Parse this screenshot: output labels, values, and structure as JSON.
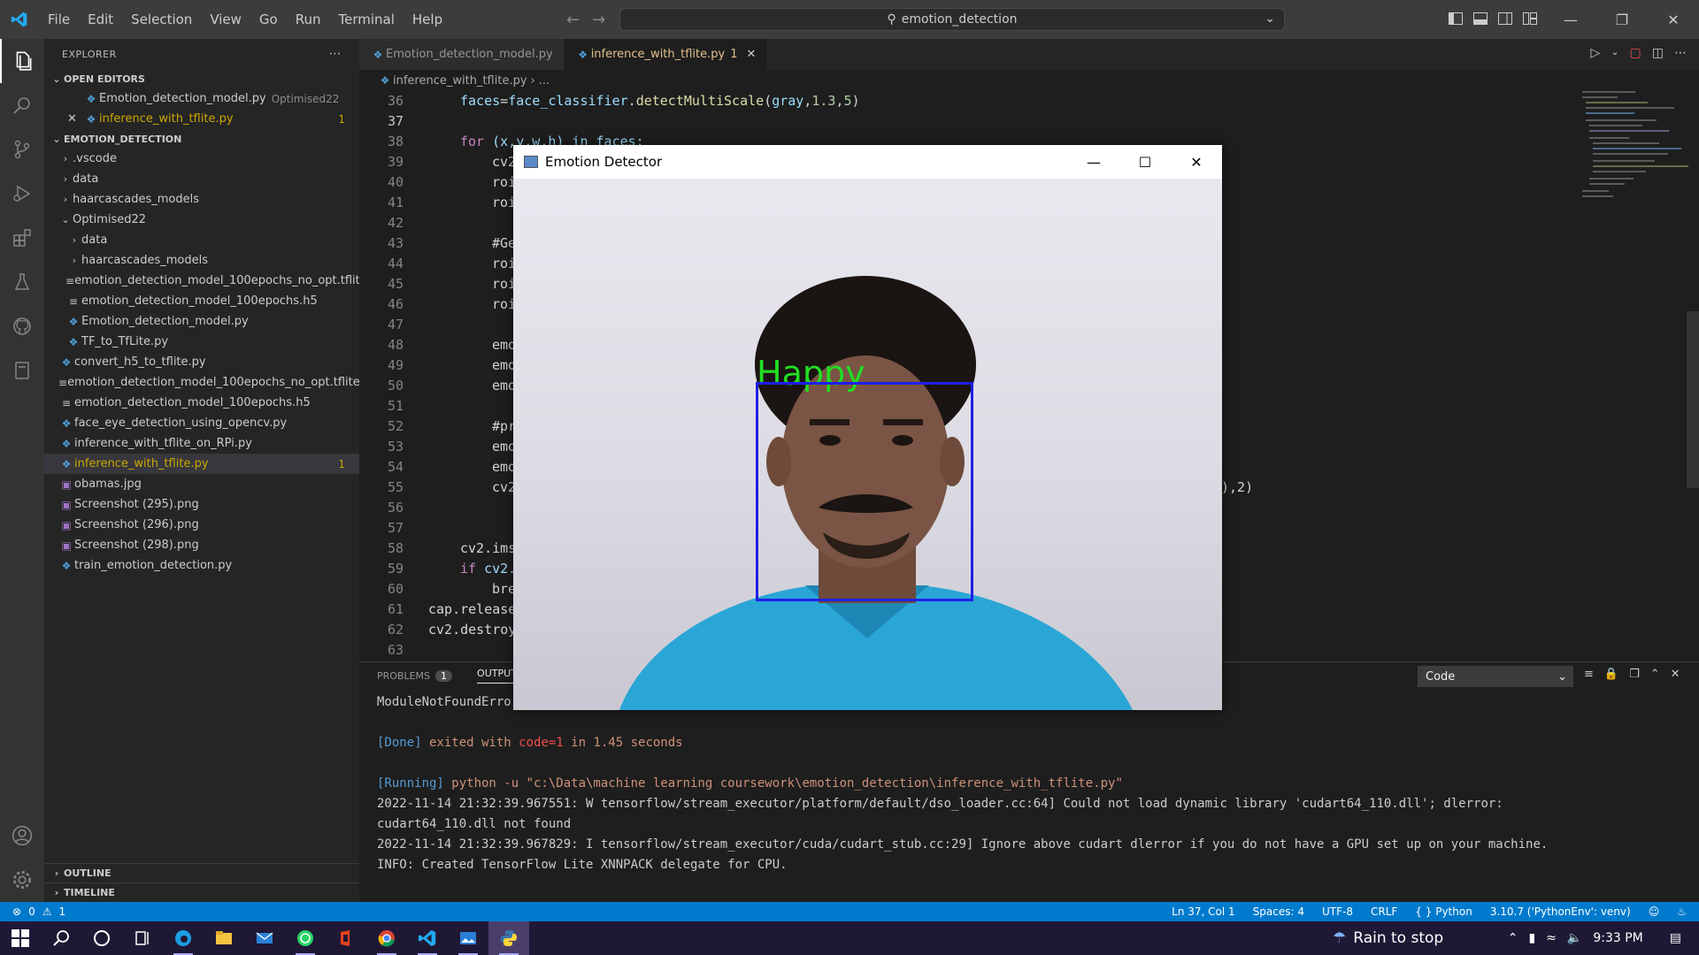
{
  "titlebar": {
    "menu": [
      "File",
      "Edit",
      "Selection",
      "View",
      "Go",
      "Run",
      "Terminal",
      "Help"
    ],
    "search": "emotion_detection"
  },
  "sidebar": {
    "header": "EXPLORER",
    "open_editors_label": "OPEN EDITORS",
    "open_editors": [
      {
        "name": "Emotion_detection_model.py",
        "desc": "Optimised22"
      },
      {
        "name": "inference_with_tflite.py",
        "badge": "1"
      }
    ],
    "project_label": "EMOTION_DETECTION",
    "tree": [
      {
        "name": ".vscode"
      },
      {
        "name": "data"
      },
      {
        "name": "haarcascades_models"
      },
      {
        "name": "Optimised22"
      },
      {
        "name": "data"
      },
      {
        "name": "haarcascades_models"
      },
      {
        "name": "emotion_detection_model_100epochs_no_opt.tflite"
      },
      {
        "name": "emotion_detection_model_100epochs.h5"
      },
      {
        "name": "Emotion_detection_model.py"
      },
      {
        "name": "TF_to_TfLite.py"
      },
      {
        "name": "convert_h5_to_tflite.py"
      },
      {
        "name": "emotion_detection_model_100epochs_no_opt.tflite"
      },
      {
        "name": "emotion_detection_model_100epochs.h5"
      },
      {
        "name": "face_eye_detection_using_opencv.py"
      },
      {
        "name": "inference_with_tflite_on_RPi.py"
      },
      {
        "name": "inference_with_tflite.py",
        "badge": "1"
      },
      {
        "name": "obamas.jpg"
      },
      {
        "name": "Screenshot (295).png"
      },
      {
        "name": "Screenshot (296).png"
      },
      {
        "name": "Screenshot (298).png"
      },
      {
        "name": "train_emotion_detection.py"
      }
    ],
    "outline_label": "OUTLINE",
    "timeline_label": "TIMELINE"
  },
  "tabs": [
    {
      "name": "Emotion_detection_model.py"
    },
    {
      "name": "inference_with_tflite.py",
      "badge": "1"
    }
  ],
  "breadcrumb": {
    "file": "inference_with_tflite.py",
    "rest": "..."
  },
  "editor": {
    "line_numbers": [
      "36",
      "37",
      "38",
      "39",
      "40",
      "41",
      "42",
      "43",
      "44",
      "45",
      "46",
      "47",
      "48",
      "49",
      "50",
      "51",
      "52",
      "53",
      "54",
      "55",
      "56",
      "57",
      "58",
      "59",
      "60",
      "61",
      "62",
      "63"
    ],
    "lines": {
      "l36_var": "faces",
      "l36_eq": "=",
      "l36_obj": "face_classifier",
      "l36_dot": ".",
      "l36_fn": "detectMultiScale",
      "l36_args_open": "(",
      "l36_arg1": "gray",
      "l36_args_rest": ",",
      "l36_n1": "1.3",
      "l36_c": ",",
      "l36_n2": "5",
      "l36_close": ")",
      "l38_kw": "for",
      "l38_rest": " (x,y,w,h) in faces:",
      "l39": "cv2",
      "l40": "roi",
      "l41": "roi",
      "l43": "#Ge",
      "l44": "roi",
      "l45": "roi",
      "l46": "roi",
      "l48": "emo",
      "l49": "emo",
      "l50": "emo",
      "l52": "#pr",
      "l53": "emo",
      "l54": "emo",
      "l55": "cv2",
      "l55_tail": "),2)",
      "l58": "cv2.ims",
      "l59_kw": "if",
      "l59_rest": " cv2.",
      "l60": "bre",
      "l61": "cap.release",
      "l62": "cv2.destroy"
    }
  },
  "panel": {
    "problems_label": "PROBLEMS",
    "problems_count": "1",
    "output_label": "OUTPUT",
    "dropdown": "Code",
    "out_line0": "ModuleNotFoundError: No module named 'tflite_runtime'",
    "out_done_tag": "[Done]",
    "out_done_text": " exited with ",
    "out_done_code": "code=1",
    "out_done_in": " in ",
    "out_done_time": "1.45 seconds",
    "out_running_tag": "[Running]",
    "out_running_cmd": " python -u \"c:\\Data\\machine learning coursework\\emotion_detection\\inference_with_tflite.py\"",
    "out_l1": "2022-11-14 21:32:39.967551: W tensorflow/stream_executor/platform/default/dso_loader.cc:64] Could not load dynamic library 'cudart64_110.dll'; dlerror:",
    "out_l2": "cudart64_110.dll not found",
    "out_l3": "2022-11-14 21:32:39.967829: I tensorflow/stream_executor/cuda/cudart_stub.cc:29] Ignore above cudart dlerror if you do not have a GPU set up on your machine.",
    "out_l4": "INFO: Created TensorFlow Lite XNNPACK delegate for CPU."
  },
  "statusbar": {
    "errors": "0",
    "warnings": "1",
    "position": "Ln 37, Col 1",
    "spaces": "Spaces: 4",
    "encoding": "UTF-8",
    "eol": "CRLF",
    "language": "Python",
    "interpreter": "3.10.7 ('PythonEnv': venv)"
  },
  "detector": {
    "title": "Emotion Detector",
    "label": "Happy"
  },
  "taskbar": {
    "weather": "Rain to stop",
    "time": "9:33 PM"
  },
  "colors": {
    "accent": "#007acc",
    "modified": "#cca700",
    "label_green": "#22dd22",
    "bbox_blue": "#1f1fe6"
  }
}
